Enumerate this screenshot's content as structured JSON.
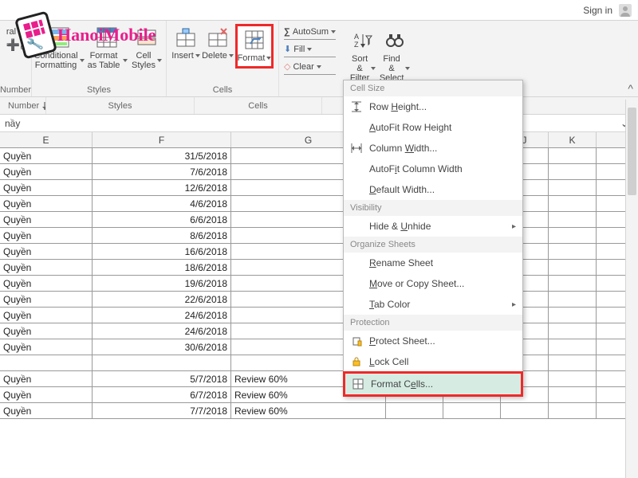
{
  "watermark": {
    "text": "HanoiMobile"
  },
  "titlebar": {
    "signin": "Sign in"
  },
  "ribbon": {
    "number_format": "ral",
    "groups": {
      "number": {
        "label": "Number"
      },
      "styles": {
        "label": "Styles",
        "conditional": "Conditional\nFormatting",
        "formatas": "Format as\nTable",
        "cellstyles": "Cell\nStyles"
      },
      "cells": {
        "label": "Cells",
        "insert": "Insert",
        "delete": "Delete",
        "format": "Format"
      },
      "editing": {
        "autosum": "AutoSum",
        "fill": "Fill",
        "clear": "Clear",
        "sort": "Sort &\nFilter",
        "find": "Find &\nSelect"
      }
    }
  },
  "formula_bar": {
    "text": "nầy"
  },
  "columns": [
    "E",
    "F",
    "G",
    "",
    "",
    "J",
    "K"
  ],
  "rows": [
    {
      "e": "Quyền",
      "f": "31/5/2018",
      "g": ""
    },
    {
      "e": "Quyền",
      "f": "7/6/2018",
      "g": ""
    },
    {
      "e": "Quyền",
      "f": "12/6/2018",
      "g": ""
    },
    {
      "e": "Quyền",
      "f": "4/6/2018",
      "g": ""
    },
    {
      "e": "Quyền",
      "f": "6/6/2018",
      "g": ""
    },
    {
      "e": "Quyền",
      "f": "8/6/2018",
      "g": ""
    },
    {
      "e": "Quyền",
      "f": "16/6/2018",
      "g": ""
    },
    {
      "e": "Quyền",
      "f": "18/6/2018",
      "g": ""
    },
    {
      "e": "Quyền",
      "f": "19/6/2018",
      "g": ""
    },
    {
      "e": "Quyền",
      "f": "22/6/2018",
      "g": ""
    },
    {
      "e": "Quyền",
      "f": "24/6/2018",
      "g": ""
    },
    {
      "e": "Quyền",
      "f": "24/6/2018",
      "g": ""
    },
    {
      "e": "Quyền",
      "f": "30/6/2018",
      "g": ""
    },
    {
      "e": "",
      "f": "",
      "g": ""
    },
    {
      "e": "Quyền",
      "f": "5/7/2018",
      "g": "Review 60%"
    },
    {
      "e": "Quyền",
      "f": "6/7/2018",
      "g": "Review 60%"
    },
    {
      "e": "Quyền",
      "f": "7/7/2018",
      "g": "Review 60%"
    }
  ],
  "menu": {
    "sections": {
      "cellsize": {
        "header": "Cell Size",
        "rowheight": "Row Height...",
        "autofitrow": "AutoFit Row Height",
        "colwidth": "Column Width...",
        "autofitcol": "AutoFit Column Width",
        "defwidth": "Default Width..."
      },
      "visibility": {
        "header": "Visibility",
        "hideunhide": "Hide & Unhide"
      },
      "organize": {
        "header": "Organize Sheets",
        "rename": "Rename Sheet",
        "move": "Move or Copy Sheet...",
        "tabcolor": "Tab Color"
      },
      "protection": {
        "header": "Protection",
        "protect": "Protect Sheet...",
        "lock": "Lock Cell",
        "formatcells": "Format Cells..."
      }
    }
  }
}
